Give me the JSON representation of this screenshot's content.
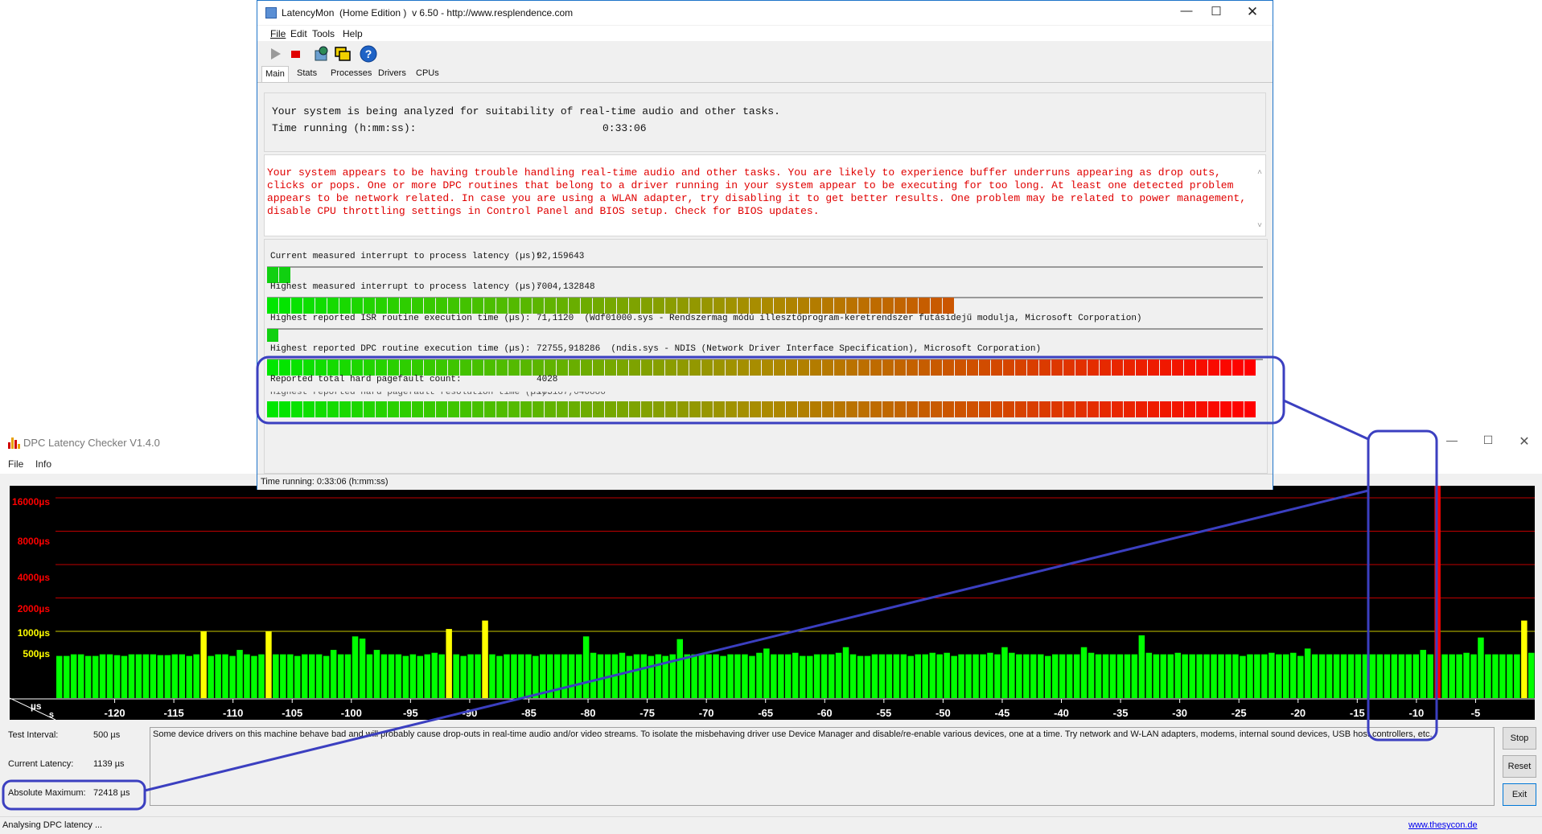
{
  "dpc": {
    "title": "DPC Latency Checker V1.4.0",
    "menu": [
      "File",
      "Info"
    ],
    "y_labels": [
      {
        "text": "16000µs",
        "color": "#ff0000"
      },
      {
        "text": "8000µs",
        "color": "#ff0000"
      },
      {
        "text": "4000µs",
        "color": "#ff0000"
      },
      {
        "text": "2000µs",
        "color": "#ff0000"
      },
      {
        "text": "1000µs",
        "color": "#ffff00"
      },
      {
        "text": "500µs",
        "color": "#ffff00"
      }
    ],
    "axis_unit_us": "µs",
    "axis_unit_s": "s",
    "x_ticks": [
      "-120",
      "-115",
      "-110",
      "-105",
      "-100",
      "-95",
      "-90",
      "-85",
      "-80",
      "-75",
      "-70",
      "-65",
      "-60",
      "-55",
      "-50",
      "-45",
      "-40",
      "-35",
      "-30",
      "-25",
      "-20",
      "-15",
      "-10",
      "-5"
    ],
    "test_interval_label": "Test Interval:",
    "test_interval_value": "500 µs",
    "current_latency_label": "Current Latency:",
    "current_latency_value": "1139 µs",
    "absolute_max_label": "Absolute Maximum:",
    "absolute_max_value": "72418 µs",
    "message": "Some device drivers on this machine behave bad and will probably cause drop-outs in real-time audio and/or video streams. To isolate the misbehaving driver use Device Manager and disable/re-enable various devices, one at a time. Try network and W-LAN adapters, modems, internal sound devices, USB host controllers, etc.",
    "buttons": {
      "stop": "Stop",
      "reset": "Reset",
      "exit": "Exit"
    },
    "status": "Analysing DPC latency ...",
    "link": "www.thesycon.de",
    "colors": {
      "normal": "#00ff00",
      "warn": "#ffff00",
      "bad": "#ff0000",
      "grid_red": "#c00000",
      "grid_yellow": "#c8c800"
    }
  },
  "chart_data": {
    "type": "bar",
    "title": "",
    "xlabel": "s",
    "ylabel": "µs",
    "xlim": [
      -125,
      0
    ],
    "y_scale": "log2",
    "y_ticks": [
      500,
      1000,
      2000,
      4000,
      8000,
      16000
    ],
    "series": [
      {
        "values": [
          600,
          600,
          620,
          620,
          600,
          600,
          620,
          620,
          610,
          600,
          620,
          620,
          620,
          620,
          610,
          610,
          620,
          620,
          600,
          620,
          1000,
          600,
          620,
          620,
          600,
          680,
          620,
          600,
          620,
          1000,
          620,
          620,
          620,
          600,
          620,
          620,
          620,
          600,
          680,
          620,
          620,
          900,
          860,
          620,
          680,
          620,
          620,
          620,
          600,
          620,
          600,
          620,
          640,
          620,
          1050,
          620,
          600,
          620,
          620,
          1250,
          620,
          600,
          620,
          620,
          620,
          620,
          600,
          620,
          620,
          620,
          620,
          620,
          620,
          900,
          640,
          620,
          620,
          620,
          640,
          600,
          620,
          620,
          600,
          620,
          600,
          620,
          850,
          620,
          620,
          620,
          620,
          620,
          600,
          620,
          620,
          620,
          600,
          640,
          700,
          620,
          620,
          620,
          640,
          600,
          600,
          620,
          620,
          620,
          640,
          720,
          620,
          600,
          600,
          620,
          620,
          620,
          620,
          620,
          600,
          620,
          620,
          640,
          620,
          640,
          600,
          620,
          620,
          620,
          620,
          640,
          620,
          720,
          640,
          620,
          620,
          620,
          620,
          600,
          620,
          620,
          620,
          620,
          720,
          640,
          620,
          620,
          620,
          620,
          620,
          620,
          920,
          640,
          620,
          620,
          620,
          640,
          620,
          620,
          620,
          620,
          620,
          620,
          620,
          620,
          600,
          620,
          620,
          620,
          640,
          620,
          620,
          640,
          600,
          700,
          620,
          620,
          620,
          620,
          620,
          620,
          620,
          620,
          620,
          620,
          620,
          620,
          620,
          620,
          620,
          680,
          620,
          72418,
          620,
          620,
          620,
          640,
          620,
          880,
          620,
          620,
          620,
          620,
          620,
          1250,
          640
        ]
      }
    ]
  },
  "latencymon": {
    "title": "LatencyMon  (Home Edition )  v 6.50 - http://www.resplendence.com",
    "menu": [
      "File",
      "Edit",
      "Tools",
      "Help"
    ],
    "tabs": [
      "Main",
      "Stats",
      "Processes",
      "Drivers",
      "CPUs"
    ],
    "analyzing_text": "Your system is being analyzed for suitability of real-time audio and other tasks.",
    "time_running_label": "Time running (h:mm:ss):",
    "time_running_value": "0:33:06",
    "warning": "Your system appears to be having trouble handling real-time audio and other tasks. You are likely to experience buffer underruns appearing as drop outs, clicks or pops. One or more DPC routines that belong to a driver running in your system appear to be executing for too long. At least one detected problem appears to be network related. In case you are using a WLAN adapter, try disabling it to get better results. One problem may be related to power management, disable CPU throttling settings in Control Panel and BIOS setup. Check for BIOS updates.",
    "metrics": [
      {
        "label": "Current measured interrupt to process latency (µs):",
        "value": "92,159643",
        "fill": 0.025
      },
      {
        "label": "Highest measured interrupt to process latency (µs):",
        "value": "7004,132848",
        "fill": 0.69
      },
      {
        "label": "Highest reported ISR routine execution time (µs):",
        "value": "71,1120  (Wdf01000.sys - Rendszermag módú illesztőprogram-keretrendszer futásidejű modulja, Microsoft Corporation)",
        "fill": 0.012
      },
      {
        "label": "Highest reported DPC routine execution time (µs):",
        "value": "72755,918286  (ndis.sys - NDIS (Network Driver Interface Specification), Microsoft Corporation)",
        "fill": 1.0
      },
      {
        "label": "Reported total hard pagefault count:",
        "value": "4028",
        "fill": 1.0
      }
    ],
    "hidden_metric_label": "Highest reported hard pagefault resolution time (µs):",
    "hidden_metric_value": "183187,046886",
    "status": "Time running: 0:33:06  (h:mm:ss)"
  }
}
